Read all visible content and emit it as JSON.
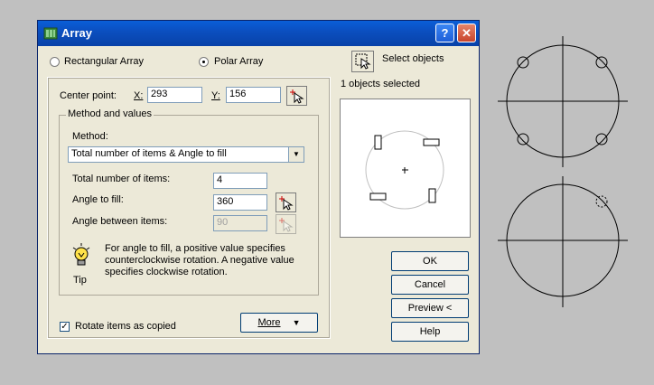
{
  "dialog": {
    "title": "Array",
    "help_glyph": "?",
    "close_glyph": "✕"
  },
  "modes": {
    "rectangular": "Rectangular Array",
    "polar": "Polar Array",
    "selected": "polar"
  },
  "center_point": {
    "label": "Center point:",
    "x_label": "X:",
    "x_value": "293",
    "y_label": "Y:",
    "y_value": "156"
  },
  "method_group": {
    "title": "Method and values",
    "method_label": "Method:",
    "method_value": "Total number of items & Angle to fill",
    "total_items_label": "Total number of items:",
    "total_items_value": "4",
    "angle_fill_label": "Angle to fill:",
    "angle_fill_value": "360",
    "angle_between_label": "Angle between items:",
    "angle_between_value": "90"
  },
  "tip": {
    "label": "Tip",
    "text": "For angle to fill, a positive value specifies counterclockwise rotation.  A negative value specifies clockwise rotation."
  },
  "rotate": {
    "label": "Rotate items as copied",
    "checked": true,
    "check_glyph": "✓"
  },
  "more_button": "More",
  "select_objects": {
    "label": "Select objects",
    "status": "1 objects selected"
  },
  "buttons": {
    "ok": "OK",
    "cancel": "Cancel",
    "preview": "Preview <",
    "help": "Help"
  }
}
